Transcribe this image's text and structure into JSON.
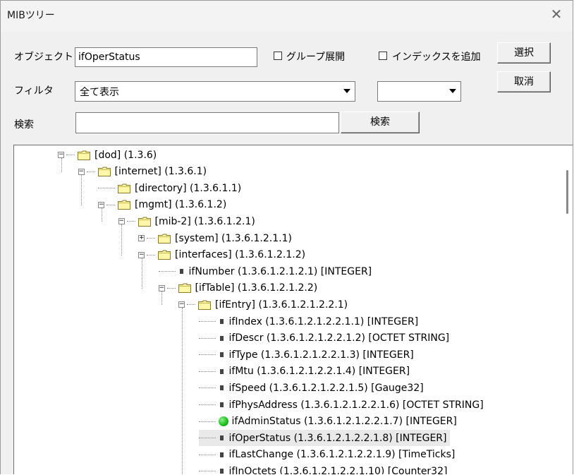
{
  "window": {
    "title": "MIBツリー",
    "close_glyph": "✕"
  },
  "form": {
    "object_label": "オブジェクト",
    "object_value": "ifOperStatus",
    "group_expand_label": "グループ展開",
    "add_index_label": "インデックスを追加",
    "select_button": "選択",
    "cancel_button": "取消",
    "filter_label": "フィルタ",
    "filter_value": "全て表示",
    "filter2_value": "",
    "search_label": "検索",
    "search_value": "",
    "search_button": "検索"
  },
  "tree": {
    "nodes": [
      {
        "text": "[dod] (1.3.6)",
        "kind": "folder",
        "expander": "−"
      },
      {
        "text": "[internet] (1.3.6.1)",
        "kind": "folder",
        "expander": "−"
      },
      {
        "text": "[directory] (1.3.6.1.1)",
        "kind": "folder",
        "expander": ""
      },
      {
        "text": "[mgmt] (1.3.6.1.2)",
        "kind": "folder",
        "expander": "−"
      },
      {
        "text": "[mib-2] (1.3.6.1.2.1)",
        "kind": "folder",
        "expander": "−"
      },
      {
        "text": "[system] (1.3.6.1.2.1.1)",
        "kind": "folder",
        "expander": "+"
      },
      {
        "text": "[interfaces] (1.3.6.1.2.1.2)",
        "kind": "folder",
        "expander": "−"
      },
      {
        "text": "ifNumber (1.3.6.1.2.1.2.1) [INTEGER]",
        "kind": "leaf"
      },
      {
        "text": "[ifTable] (1.3.6.1.2.1.2.2)",
        "kind": "folder",
        "expander": "−"
      },
      {
        "text": "[ifEntry] (1.3.6.1.2.1.2.2.1)",
        "kind": "folder",
        "expander": "−"
      },
      {
        "text": "ifIndex (1.3.6.1.2.1.2.2.1.1) [INTEGER]",
        "kind": "leaf"
      },
      {
        "text": "ifDescr (1.3.6.1.2.1.2.2.1.2) [OCTET STRING]",
        "kind": "leaf"
      },
      {
        "text": "ifType (1.3.6.1.2.1.2.2.1.3) [INTEGER]",
        "kind": "leaf"
      },
      {
        "text": "ifMtu (1.3.6.1.2.1.2.2.1.4) [INTEGER]",
        "kind": "leaf"
      },
      {
        "text": "ifSpeed (1.3.6.1.2.1.2.2.1.5) [Gauge32]",
        "kind": "leaf"
      },
      {
        "text": "ifPhysAddress (1.3.6.1.2.1.2.2.1.6) [OCTET STRING]",
        "kind": "leaf"
      },
      {
        "text": "ifAdminStatus (1.3.6.1.2.1.2.2.1.7) [INTEGER]",
        "kind": "marked",
        "marker_color": "#1fc21f"
      },
      {
        "text": "ifOperStatus (1.3.6.1.2.1.2.2.1.8) [INTEGER]",
        "kind": "leaf",
        "selected": true
      },
      {
        "text": "ifLastChange (1.3.6.1.2.1.2.2.1.9) [TimeTicks]",
        "kind": "leaf"
      },
      {
        "text": "ifInOctets (1.3.6.1.2.1.2.2.1.10) [Counter32]",
        "kind": "leaf"
      }
    ]
  }
}
